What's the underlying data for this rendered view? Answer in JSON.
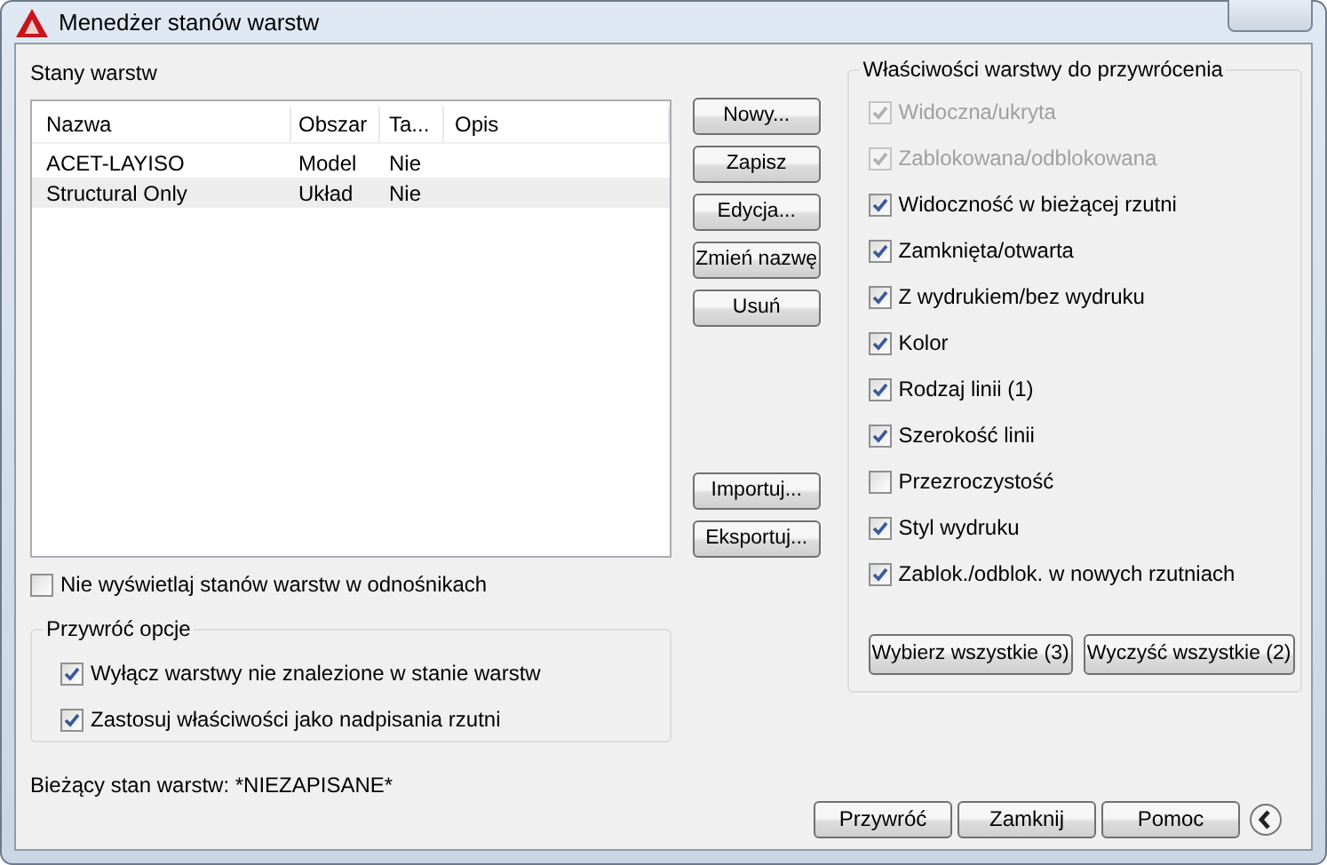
{
  "window": {
    "title": "Menedżer stanów warstw"
  },
  "layer_states": {
    "label": "Stany warstw",
    "columns": [
      "Nazwa",
      "Obszar",
      "Ta...",
      "Opis"
    ],
    "rows": [
      {
        "name": "ACET-LAYISO",
        "space": "Model",
        "column_3": "Nie",
        "selected": false
      },
      {
        "name": "Structural Only",
        "space": "Układ",
        "column_3": "Nie",
        "selected": true
      }
    ]
  },
  "state_buttons": [
    "Nowy...",
    "Zapisz",
    "Edycja...",
    "Zmień nazwę",
    "Usuń"
  ],
  "transfer_buttons": [
    "Importuj...",
    "Eksportuj..."
  ],
  "hide_xref": {
    "label": "Nie wyświetlaj stanów warstw w odnośnikach",
    "checked": false
  },
  "restore_options": {
    "title": "Przywróć opcje",
    "items": [
      {
        "label": "Wyłącz warstwy nie znalezione w stanie warstw",
        "checked": true
      },
      {
        "label": "Zastosuj właściwości jako nadpisania rzutni",
        "checked": true
      }
    ]
  },
  "properties": {
    "title": "Właściwości warstwy do przywrócenia",
    "items": [
      {
        "label": "Widoczna/ukryta",
        "checked": true,
        "disabled": true
      },
      {
        "label": "Zablokowana/odblokowana",
        "checked": true,
        "disabled": true
      },
      {
        "label": "Widoczność w bieżącej rzutni",
        "checked": true,
        "disabled": false
      },
      {
        "label": "Zamknięta/otwarta",
        "checked": true,
        "disabled": false
      },
      {
        "label": "Z wydrukiem/bez wydruku",
        "checked": true,
        "disabled": false
      },
      {
        "label": "Kolor",
        "checked": true,
        "disabled": false
      },
      {
        "label": "Rodzaj linii (1)",
        "checked": true,
        "disabled": false
      },
      {
        "label": "Szerokość linii",
        "checked": true,
        "disabled": false
      },
      {
        "label": "Przezroczystość",
        "checked": false,
        "disabled": false
      },
      {
        "label": "Styl wydruku",
        "checked": true,
        "disabled": false
      },
      {
        "label": "Zablok./odblok. w nowych rzutniach",
        "checked": true,
        "disabled": false
      }
    ],
    "buttons": [
      "Wybierz wszystkie (3)",
      "Wyczyść wszystkie (2)"
    ]
  },
  "current_state": "Bieżący stan warstw: *NIEZAPISANE*",
  "footer_buttons": [
    "Przywróć",
    "Zamknij",
    "Pomoc"
  ]
}
